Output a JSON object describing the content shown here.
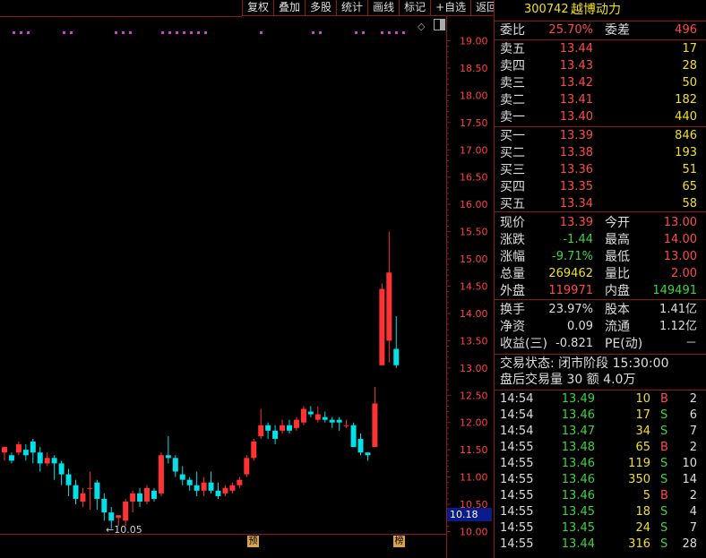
{
  "toolbar": {
    "items": [
      "复权",
      "叠加",
      "多股",
      "统计",
      "画线",
      "标记",
      "+自选",
      "返回"
    ]
  },
  "price_axis": {
    "labels": [
      "19.00",
      "18.50",
      "18.00",
      "17.50",
      "17.00",
      "16.50",
      "16.00",
      "15.50",
      "15.00",
      "14.50",
      "14.00",
      "13.50",
      "13.00",
      "12.50",
      "12.00",
      "11.50",
      "11.00",
      "10.50",
      "10.00"
    ],
    "current_price": "10.18"
  },
  "chart_data": {
    "type": "candlestick",
    "ylim": [
      10.0,
      19.0
    ],
    "low_annotation": "10.05",
    "markers": [
      "预",
      "榜"
    ],
    "candles": [
      [
        11.45,
        11.55,
        11.55,
        11.3
      ],
      [
        11.4,
        11.3,
        11.45,
        11.25
      ],
      [
        11.45,
        11.6,
        11.65,
        11.4
      ],
      [
        11.5,
        11.4,
        11.6,
        11.3
      ],
      [
        11.65,
        11.45,
        11.7,
        11.25
      ],
      [
        11.45,
        11.25,
        11.55,
        11.1
      ],
      [
        11.25,
        11.35,
        11.45,
        11.2
      ],
      [
        11.35,
        11.25,
        11.4,
        10.95
      ],
      [
        11.25,
        11.05,
        11.3,
        10.85
      ],
      [
        11.05,
        10.85,
        11.15,
        10.65
      ],
      [
        10.85,
        10.6,
        10.95,
        10.5
      ],
      [
        10.55,
        10.7,
        10.8,
        10.45
      ],
      [
        10.8,
        10.8,
        11.1,
        10.4
      ],
      [
        10.9,
        10.6,
        10.95,
        10.4
      ],
      [
        10.6,
        10.35,
        10.7,
        10.2
      ],
      [
        10.35,
        10.2,
        10.45,
        10.05
      ],
      [
        10.25,
        10.3,
        10.3,
        10.1
      ],
      [
        10.2,
        10.55,
        10.6,
        10.1
      ],
      [
        10.55,
        10.7,
        10.75,
        10.35
      ],
      [
        10.7,
        10.55,
        10.8,
        10.45
      ],
      [
        10.55,
        10.8,
        10.85,
        10.5
      ],
      [
        10.75,
        10.6,
        10.8,
        10.55
      ],
      [
        10.7,
        11.4,
        11.45,
        10.65
      ],
      [
        11.4,
        11.35,
        11.75,
        11.25
      ],
      [
        11.35,
        11.1,
        11.4,
        11.0
      ],
      [
        11.05,
        10.95,
        11.2,
        10.85
      ],
      [
        10.95,
        10.85,
        11.0,
        10.75
      ],
      [
        10.85,
        10.75,
        11.1,
        10.65
      ],
      [
        10.75,
        10.9,
        11.0,
        10.65
      ],
      [
        10.9,
        10.75,
        11.1,
        10.7
      ],
      [
        10.75,
        10.65,
        10.9,
        10.6
      ],
      [
        10.7,
        10.8,
        10.85,
        10.65
      ],
      [
        10.75,
        10.85,
        10.9,
        10.7
      ],
      [
        10.85,
        10.95,
        11.0,
        10.8
      ],
      [
        11.05,
        11.35,
        11.4,
        11.0
      ],
      [
        11.35,
        11.65,
        11.7,
        11.3
      ],
      [
        11.75,
        11.95,
        12.25,
        11.7
      ],
      [
        11.95,
        11.85,
        12.0,
        11.7
      ],
      [
        11.85,
        11.7,
        11.95,
        11.6
      ],
      [
        11.85,
        11.95,
        12.05,
        11.8
      ],
      [
        11.95,
        11.85,
        12.05,
        11.8
      ],
      [
        11.9,
        12.05,
        12.1,
        11.85
      ],
      [
        12.0,
        12.25,
        12.3,
        11.95
      ],
      [
        12.2,
        12.15,
        12.3,
        12.1
      ],
      [
        12.05,
        12.15,
        12.3,
        12.0
      ],
      [
        12.1,
        12.05,
        12.2,
        12.0
      ],
      [
        12.05,
        12.0,
        12.1,
        11.9
      ],
      [
        12.05,
        12.0,
        12.1,
        11.85
      ],
      [
        11.95,
        11.95,
        12.05,
        11.9
      ],
      [
        11.95,
        11.55,
        12.0,
        11.55
      ],
      [
        11.7,
        11.45,
        11.8,
        11.4
      ],
      [
        11.45,
        11.4,
        11.45,
        11.3
      ],
      [
        11.55,
        12.35,
        12.65,
        11.55
      ],
      [
        13.05,
        14.45,
        14.55,
        13.05
      ],
      [
        13.5,
        14.75,
        15.5,
        13.1
      ],
      [
        13.35,
        13.05,
        13.95,
        13.0
      ]
    ]
  },
  "quote": {
    "code": "300742",
    "name": "越博动力",
    "weibi_label": "委比",
    "weibi": "25.70%",
    "weicha_label": "委差",
    "weicha": "496",
    "sells": [
      {
        "label": "卖五",
        "price": "13.44",
        "vol": "17"
      },
      {
        "label": "卖四",
        "price": "13.43",
        "vol": "28"
      },
      {
        "label": "卖三",
        "price": "13.42",
        "vol": "50"
      },
      {
        "label": "卖二",
        "price": "13.41",
        "vol": "182"
      },
      {
        "label": "卖一",
        "price": "13.40",
        "vol": "440"
      }
    ],
    "buys": [
      {
        "label": "买一",
        "price": "13.39",
        "vol": "846"
      },
      {
        "label": "买二",
        "price": "13.38",
        "vol": "193"
      },
      {
        "label": "买三",
        "price": "13.36",
        "vol": "51"
      },
      {
        "label": "买四",
        "price": "13.35",
        "vol": "65"
      },
      {
        "label": "买五",
        "price": "13.34",
        "vol": "58"
      }
    ],
    "stats": [
      {
        "l1": "现价",
        "v1": "13.39",
        "l2": "今开",
        "v2": "13.00"
      },
      {
        "l1": "涨跌",
        "v1": "-1.44",
        "l2": "最高",
        "v2": "14.00"
      },
      {
        "l1": "涨幅",
        "v1": "-9.71%",
        "l2": "最低",
        "v2": "13.00"
      },
      {
        "l1": "总量",
        "v1": "269462",
        "l2": "量比",
        "v2": "2.00"
      },
      {
        "l1": "外盘",
        "v1": "119971",
        "l2": "内盘",
        "v2": "149491"
      }
    ],
    "fund": [
      {
        "l1": "换手",
        "v1": "23.97%",
        "l2": "股本",
        "v2": "1.41亿"
      },
      {
        "l1": "净资",
        "v1": "0.09",
        "l2": "流通",
        "v2": "1.12亿"
      },
      {
        "l1": "收益(三)",
        "v1": "-0.821",
        "l2": "PE(动)",
        "v2": "－"
      }
    ],
    "status": "交易状态: 闭市阶段 15:30:00",
    "after": "盘后交易量 30 额 4.0万",
    "ticks": [
      {
        "t": "14:54",
        "p": "13.49",
        "v": "10",
        "s": "B",
        "n": "2"
      },
      {
        "t": "14:54",
        "p": "13.46",
        "v": "17",
        "s": "S",
        "n": "6"
      },
      {
        "t": "14:54",
        "p": "13.47",
        "v": "34",
        "s": "S",
        "n": "7"
      },
      {
        "t": "14:55",
        "p": "13.48",
        "v": "65",
        "s": "B",
        "n": "2"
      },
      {
        "t": "14:55",
        "p": "13.46",
        "v": "119",
        "s": "S",
        "n": "10"
      },
      {
        "t": "14:55",
        "p": "13.46",
        "v": "350",
        "s": "S",
        "n": "14"
      },
      {
        "t": "14:55",
        "p": "13.46",
        "v": "5",
        "s": "B",
        "n": "2"
      },
      {
        "t": "14:55",
        "p": "13.45",
        "v": "18",
        "s": "S",
        "n": "4"
      },
      {
        "t": "14:55",
        "p": "13.45",
        "v": "24",
        "s": "S",
        "n": "7"
      },
      {
        "t": "14:55",
        "p": "13.44",
        "v": "316",
        "s": "S",
        "n": "28"
      }
    ]
  },
  "colors": {
    "up": "#ff3333",
    "down": "#00e0e8",
    "grid": "#8a1a1a"
  }
}
